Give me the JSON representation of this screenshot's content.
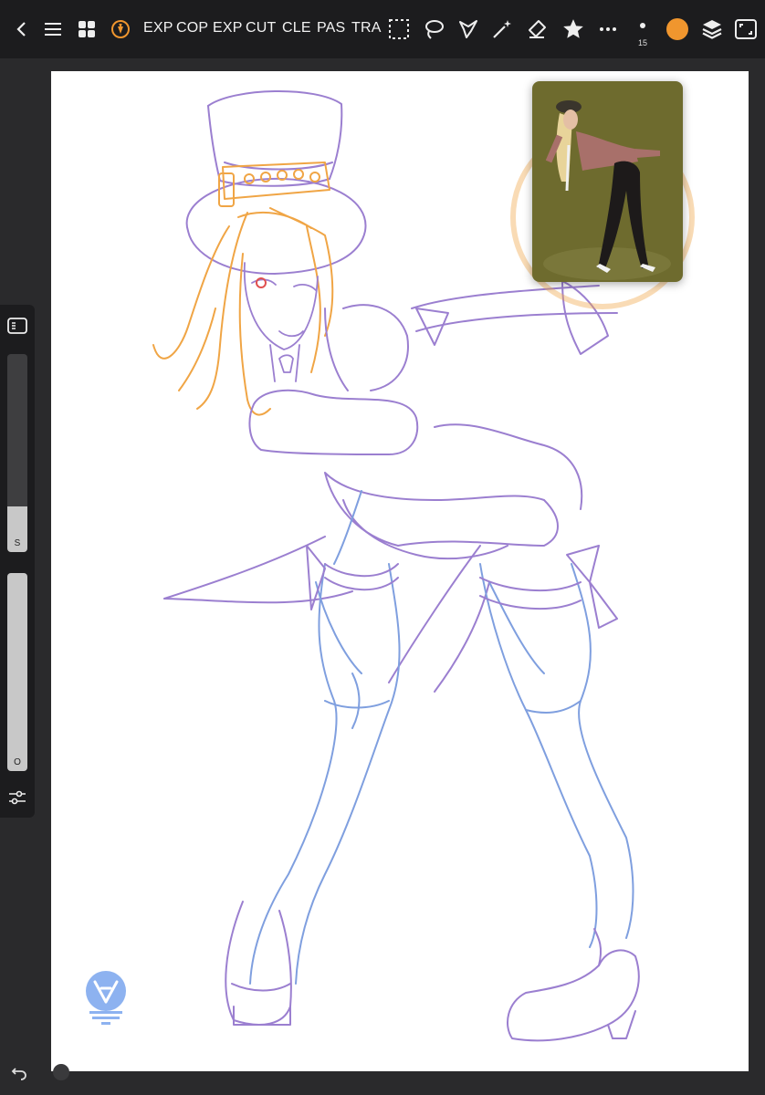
{
  "toolbar": {
    "left_icons": [
      "back-icon",
      "menu-icon",
      "gallery-grid-icon",
      "app-logo-icon"
    ],
    "text_actions": [
      "EXP",
      "COP",
      "EXP",
      "CUT",
      "CLE",
      "PAS",
      "TRA"
    ],
    "tools": [
      "selection-icon",
      "lasso-icon",
      "polygon-lasso-icon",
      "magic-wand-icon",
      "eraser-icon",
      "favorites-star-icon",
      "more-icon"
    ],
    "brush_size_value": "15",
    "current_color": "#F0962E",
    "right_icons": [
      "layers-icon",
      "fullscreen-icon"
    ]
  },
  "sidebar": {
    "size_slider_label": "S",
    "size_level_pct": 23,
    "opacity_slider_label": "O",
    "opacity_level_pct": 100
  },
  "reference": {
    "background_color": "#6E6B2E"
  },
  "sketch_colors": {
    "purple": "#9B7FD0",
    "orange": "#F0A545",
    "blue": "#7F9FDF"
  }
}
